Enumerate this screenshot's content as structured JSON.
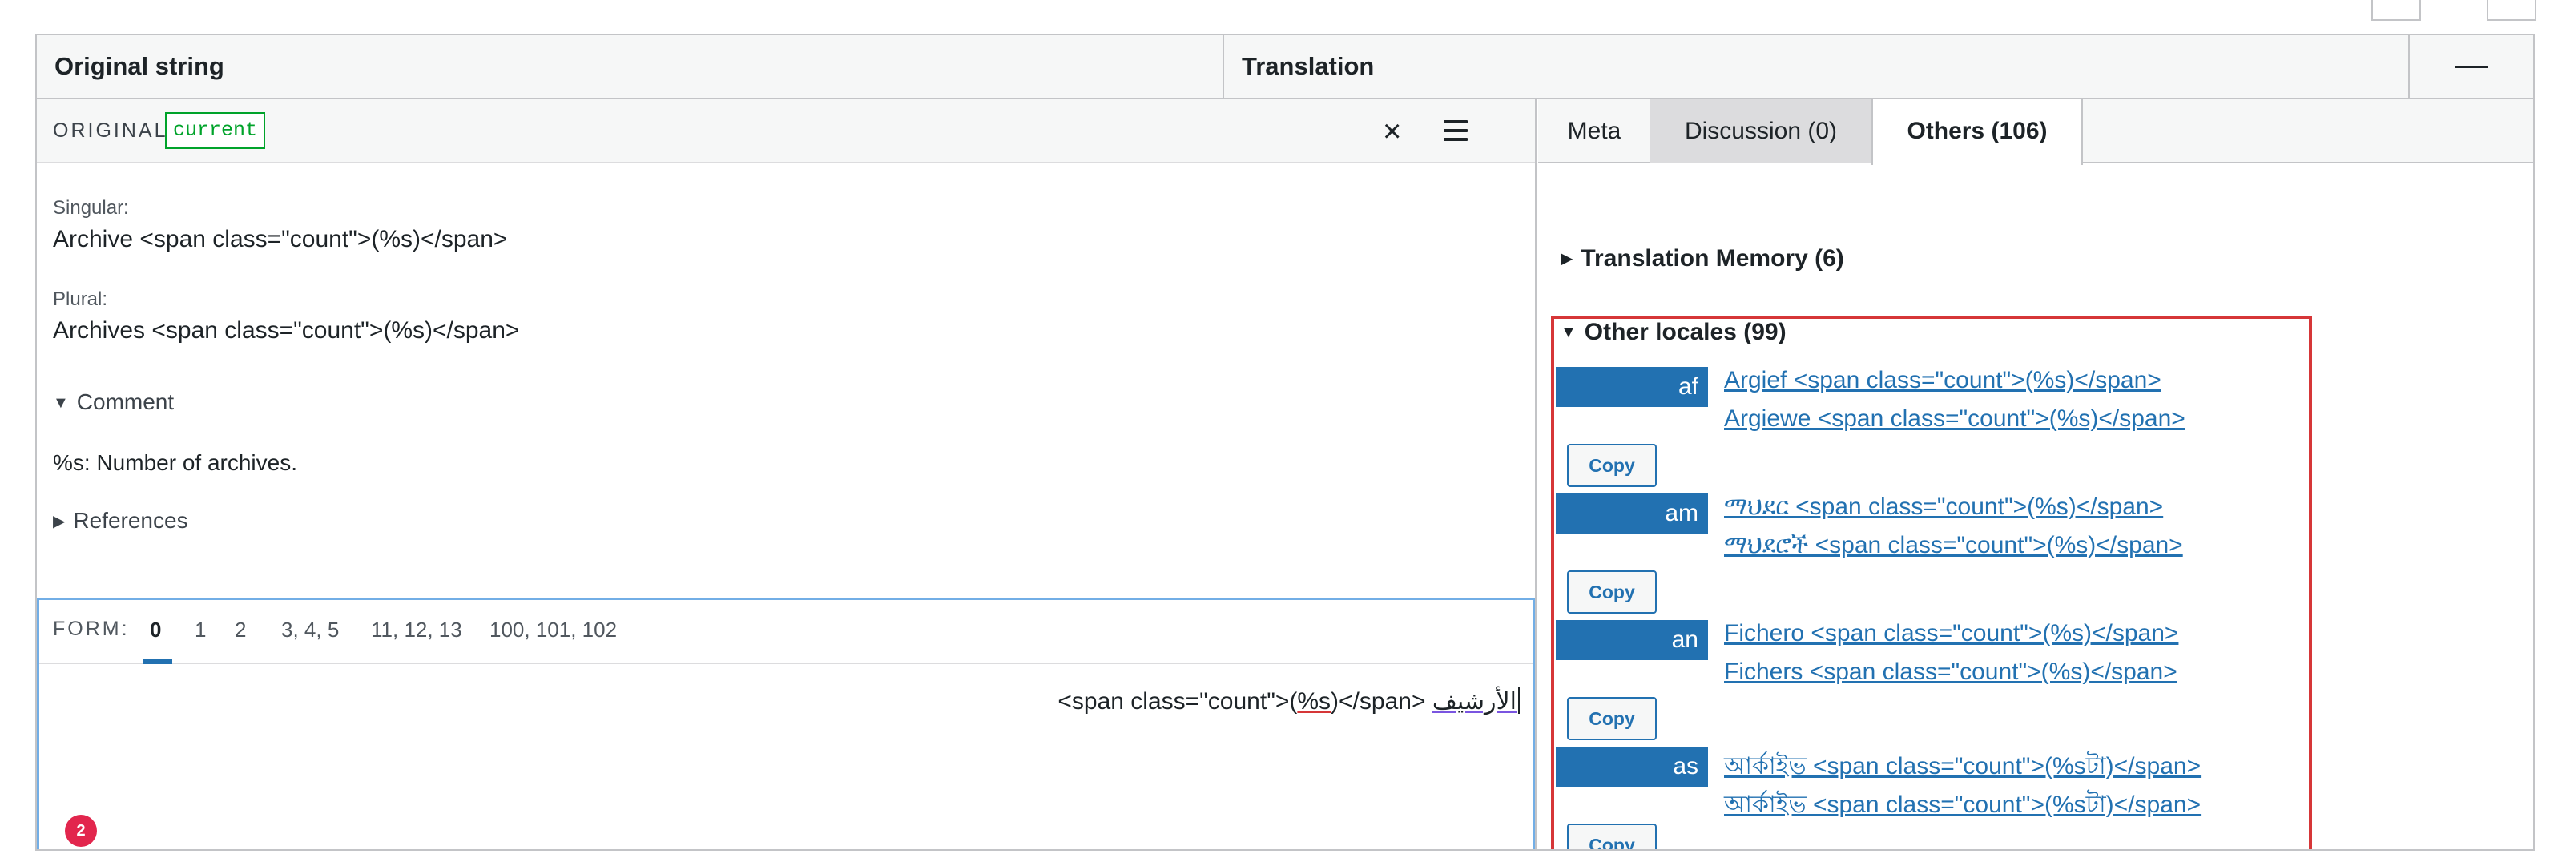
{
  "header": {
    "original_col": "Original string",
    "translation_col": "Translation",
    "collapse_glyph": "—"
  },
  "original_panel": {
    "label": "ORIGINAL",
    "badge": "current",
    "close_glyph": "×",
    "singular_label": "Singular:",
    "singular_value": "Archive <span class=\"count\">(%s)</span>",
    "plural_label": "Plural:",
    "plural_value": "Archives <span class=\"count\">(%s)</span>",
    "comment_toggle": "Comment",
    "comment_text": "%s: Number of archives.",
    "references_toggle": "References"
  },
  "editor": {
    "form_label": "FORM:",
    "forms": [
      "0",
      "1",
      "2",
      "3, 4, 5",
      "11, 12, 13",
      "100, 101, 102"
    ],
    "active_form": "0",
    "translation_parts": [
      "<span class=\"count\">(",
      "%s",
      ")</span> ",
      "الأرشيف"
    ],
    "notification_count": "2"
  },
  "tabs": [
    {
      "label": "Meta"
    },
    {
      "label": "Discussion (0)"
    },
    {
      "label": "Others (106)",
      "active": true
    }
  ],
  "others": {
    "tm_title": "Translation Memory (6)",
    "locales_title": "Other locales (99)",
    "copy_label": "Copy",
    "locales": [
      {
        "code": "af",
        "singular": "Argief <span class=\"count\">(%s)</span>",
        "plural": "Argiewe <span class=\"count\">(%s)</span>"
      },
      {
        "code": "am",
        "singular": "ማህደር <span class=\"count\">(%s)</span>",
        "plural": "ማህደሮች <span class=\"count\">(%s)</span>"
      },
      {
        "code": "an",
        "singular": "Fichero <span class=\"count\">(%s)</span>",
        "plural": "Fichers <span class=\"count\">(%s)</span>"
      },
      {
        "code": "as",
        "singular": "আৰ্কাইভ <span class=\"count\">(%sটা)</span>",
        "plural": "আৰ্কাইভ <span class=\"count\">(%sটা)</span>"
      }
    ]
  },
  "colors": {
    "accent": "#2271b1",
    "current_badge": "#00a32a",
    "highlight_border": "#d63638",
    "notification": "#e2264d"
  }
}
